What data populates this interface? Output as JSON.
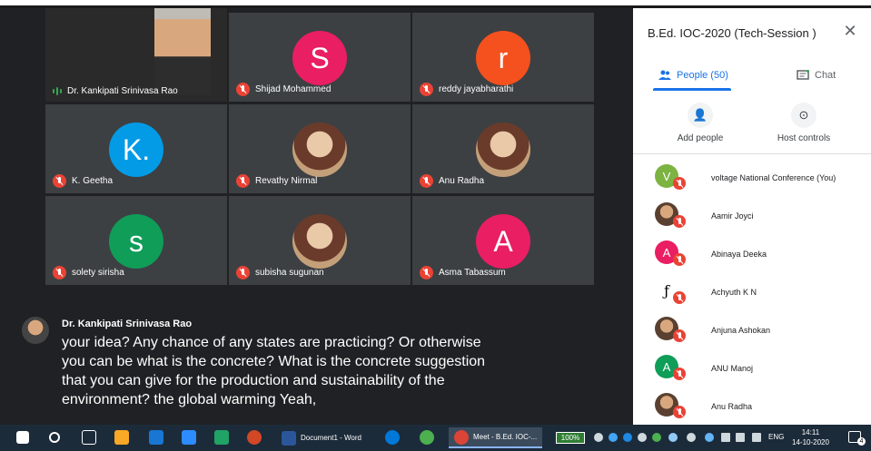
{
  "meeting": {
    "panel_title": "B.Ed. IOC-2020 (Tech-Session )",
    "close_icon": "close-icon",
    "tabs": [
      {
        "label": "People (50)",
        "icon": "people-icon"
      },
      {
        "label": "Chat",
        "icon": "chat-icon"
      }
    ],
    "actions": [
      {
        "label": "Add people",
        "icon": "add-person-icon"
      },
      {
        "label": "Host controls",
        "icon": "host-controls-icon"
      }
    ],
    "participants": [
      {
        "name": "voltage National Conference (You)",
        "initial": "V",
        "color": "#34a853"
      },
      {
        "name": "Aamir Joyci",
        "initial": "",
        "color": "#6b4a3a"
      },
      {
        "name": "Abinaya Deeka",
        "initial": "A",
        "color": "#e91e63"
      },
      {
        "name": "Achyuth K N",
        "initial": "ƒ",
        "color": "#ffffff"
      },
      {
        "name": "Anjuna Ashokan",
        "initial": "",
        "color": "#6b4a3a"
      },
      {
        "name": "ANU Manoj",
        "initial": "A",
        "color": "#0f9d58"
      },
      {
        "name": "Anu Radha",
        "initial": "",
        "color": "#6b4a3a"
      }
    ]
  },
  "grid": {
    "tiles": [
      {
        "name": "Dr. Kankipati Srinivasa Rao",
        "initial": "",
        "color": "#444",
        "speaking": true
      },
      {
        "name": "Shijad Mohammed",
        "initial": "S",
        "color": "#e91e63"
      },
      {
        "name": "reddy jayabharathi",
        "initial": "r",
        "color": "#f4511e"
      },
      {
        "name": "K. Geetha",
        "initial": "K.",
        "color": "#039be5"
      },
      {
        "name": "Revathy Nirmal",
        "initial": "",
        "color": "#8d5b3c"
      },
      {
        "name": "Anu Radha",
        "initial": "",
        "color": "#8d5b3c"
      },
      {
        "name": "solety sirisha",
        "initial": "s",
        "color": "#0f9d58"
      },
      {
        "name": "subisha sugunan",
        "initial": "",
        "color": "#8d5b3c"
      },
      {
        "name": "Asma Tabassum",
        "initial": "A",
        "color": "#e91e63"
      }
    ]
  },
  "caption": {
    "speaker": "Dr. Kankipati Srinivasa Rao",
    "lines": [
      "your idea? Any chance of any states are practicing? Or otherwise",
      "you can be what is the concrete? What is the concrete suggestion",
      "that you can give for the production and sustainability of the",
      "environment? the global warming Yeah,"
    ]
  },
  "taskbar": {
    "apps": [
      {
        "label": "Document1 - Word",
        "icon": "word-icon"
      },
      {
        "label": "Meet - B.Ed. IOC-...",
        "icon": "chrome-icon"
      }
    ],
    "battery": "100%",
    "language": "ENG",
    "time": "14:11",
    "date": "14-10-2020",
    "notification_count": "4"
  }
}
